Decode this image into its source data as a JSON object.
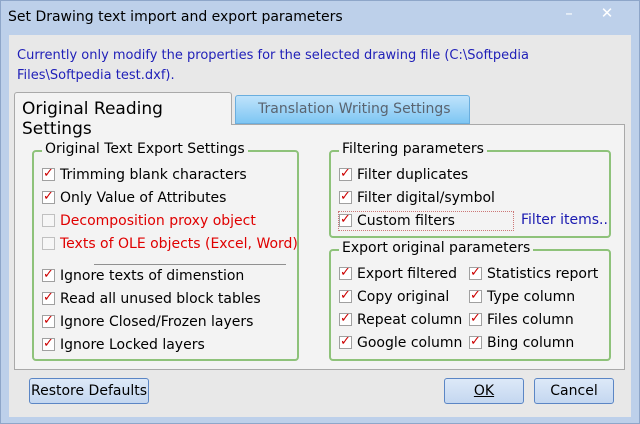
{
  "window": {
    "title": "Set Drawing text import and export parameters",
    "minimize": "–",
    "close": "✕"
  },
  "info_text": "Currently only modify the properties for the selected drawing file (C:\\Softpedia Files\\Softpedia test.dxf).",
  "tabs": [
    {
      "label": "Original Reading Settings",
      "active": true
    },
    {
      "label": "Translation Writing Settings",
      "active": false
    }
  ],
  "original_text_export": {
    "title": "Original Text Export Settings",
    "items": [
      {
        "label": "Trimming blank characters",
        "checked": true
      },
      {
        "label": "Only Value of Attributes",
        "checked": true
      },
      {
        "label": "Decomposition proxy object",
        "checked": false
      },
      {
        "label": "Texts of OLE objects (Excel, Word)",
        "checked": false
      },
      {
        "label": "Ignore texts of dimenstion",
        "checked": true
      },
      {
        "label": "Read all unused block tables",
        "checked": true
      },
      {
        "label": "Ignore Closed/Frozen layers",
        "checked": true
      },
      {
        "label": "Ignore Locked layers",
        "checked": true
      }
    ]
  },
  "filtering": {
    "title": "Filtering parameters",
    "items": [
      {
        "label": "Filter duplicates",
        "checked": true
      },
      {
        "label": "Filter digital/symbol",
        "checked": true
      },
      {
        "label": "Custom filters",
        "checked": true
      }
    ],
    "filter_items_link": "Filter items.."
  },
  "export_original": {
    "title": "Export original parameters",
    "items": [
      {
        "label": "Export filtered",
        "checked": true
      },
      {
        "label": "Statistics report",
        "checked": true
      },
      {
        "label": "Copy original",
        "checked": true
      },
      {
        "label": "Type column",
        "checked": true
      },
      {
        "label": "Repeat column",
        "checked": true
      },
      {
        "label": "Files column",
        "checked": true
      },
      {
        "label": "Google column",
        "checked": true
      },
      {
        "label": "Bing column",
        "checked": true
      }
    ]
  },
  "buttons": {
    "restore": "Restore Defaults",
    "ok": "OK",
    "cancel": "Cancel"
  },
  "colors": {
    "accent_text": "#1f1fb8",
    "check": "#cc0000",
    "group_border": "#8ec27a",
    "frame": "#bdd0ea"
  }
}
